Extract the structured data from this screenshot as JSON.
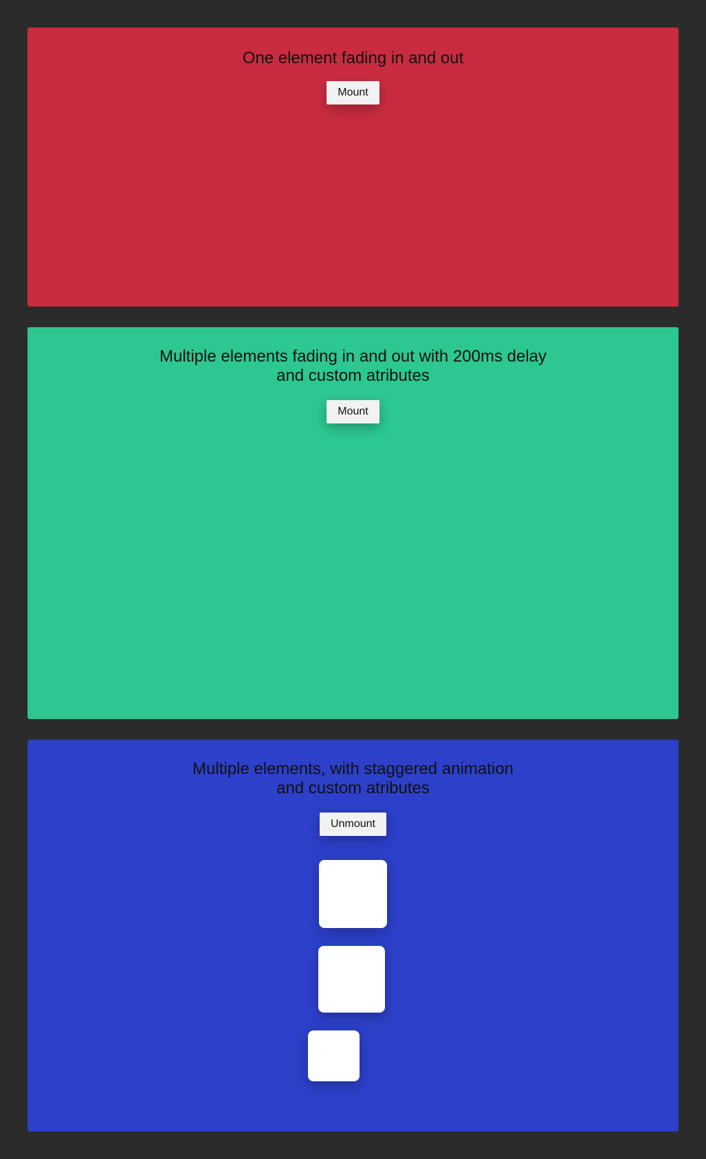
{
  "panels": [
    {
      "title": "One element fading in and out",
      "button_label": "Mount",
      "color": "#c92c40"
    },
    {
      "title": "Multiple elements fading in and out with 200ms delay\nand custom atributes",
      "button_label": "Mount",
      "color": "#2dc792"
    },
    {
      "title": "Multiple elements, with staggered animation\nand custom atributes",
      "button_label": "Unmount",
      "color": "#2c40c9"
    }
  ],
  "colors": {
    "page_background": "#2b2b2b",
    "button_background": "#f2f2f2",
    "box_background": "#ffffff"
  }
}
